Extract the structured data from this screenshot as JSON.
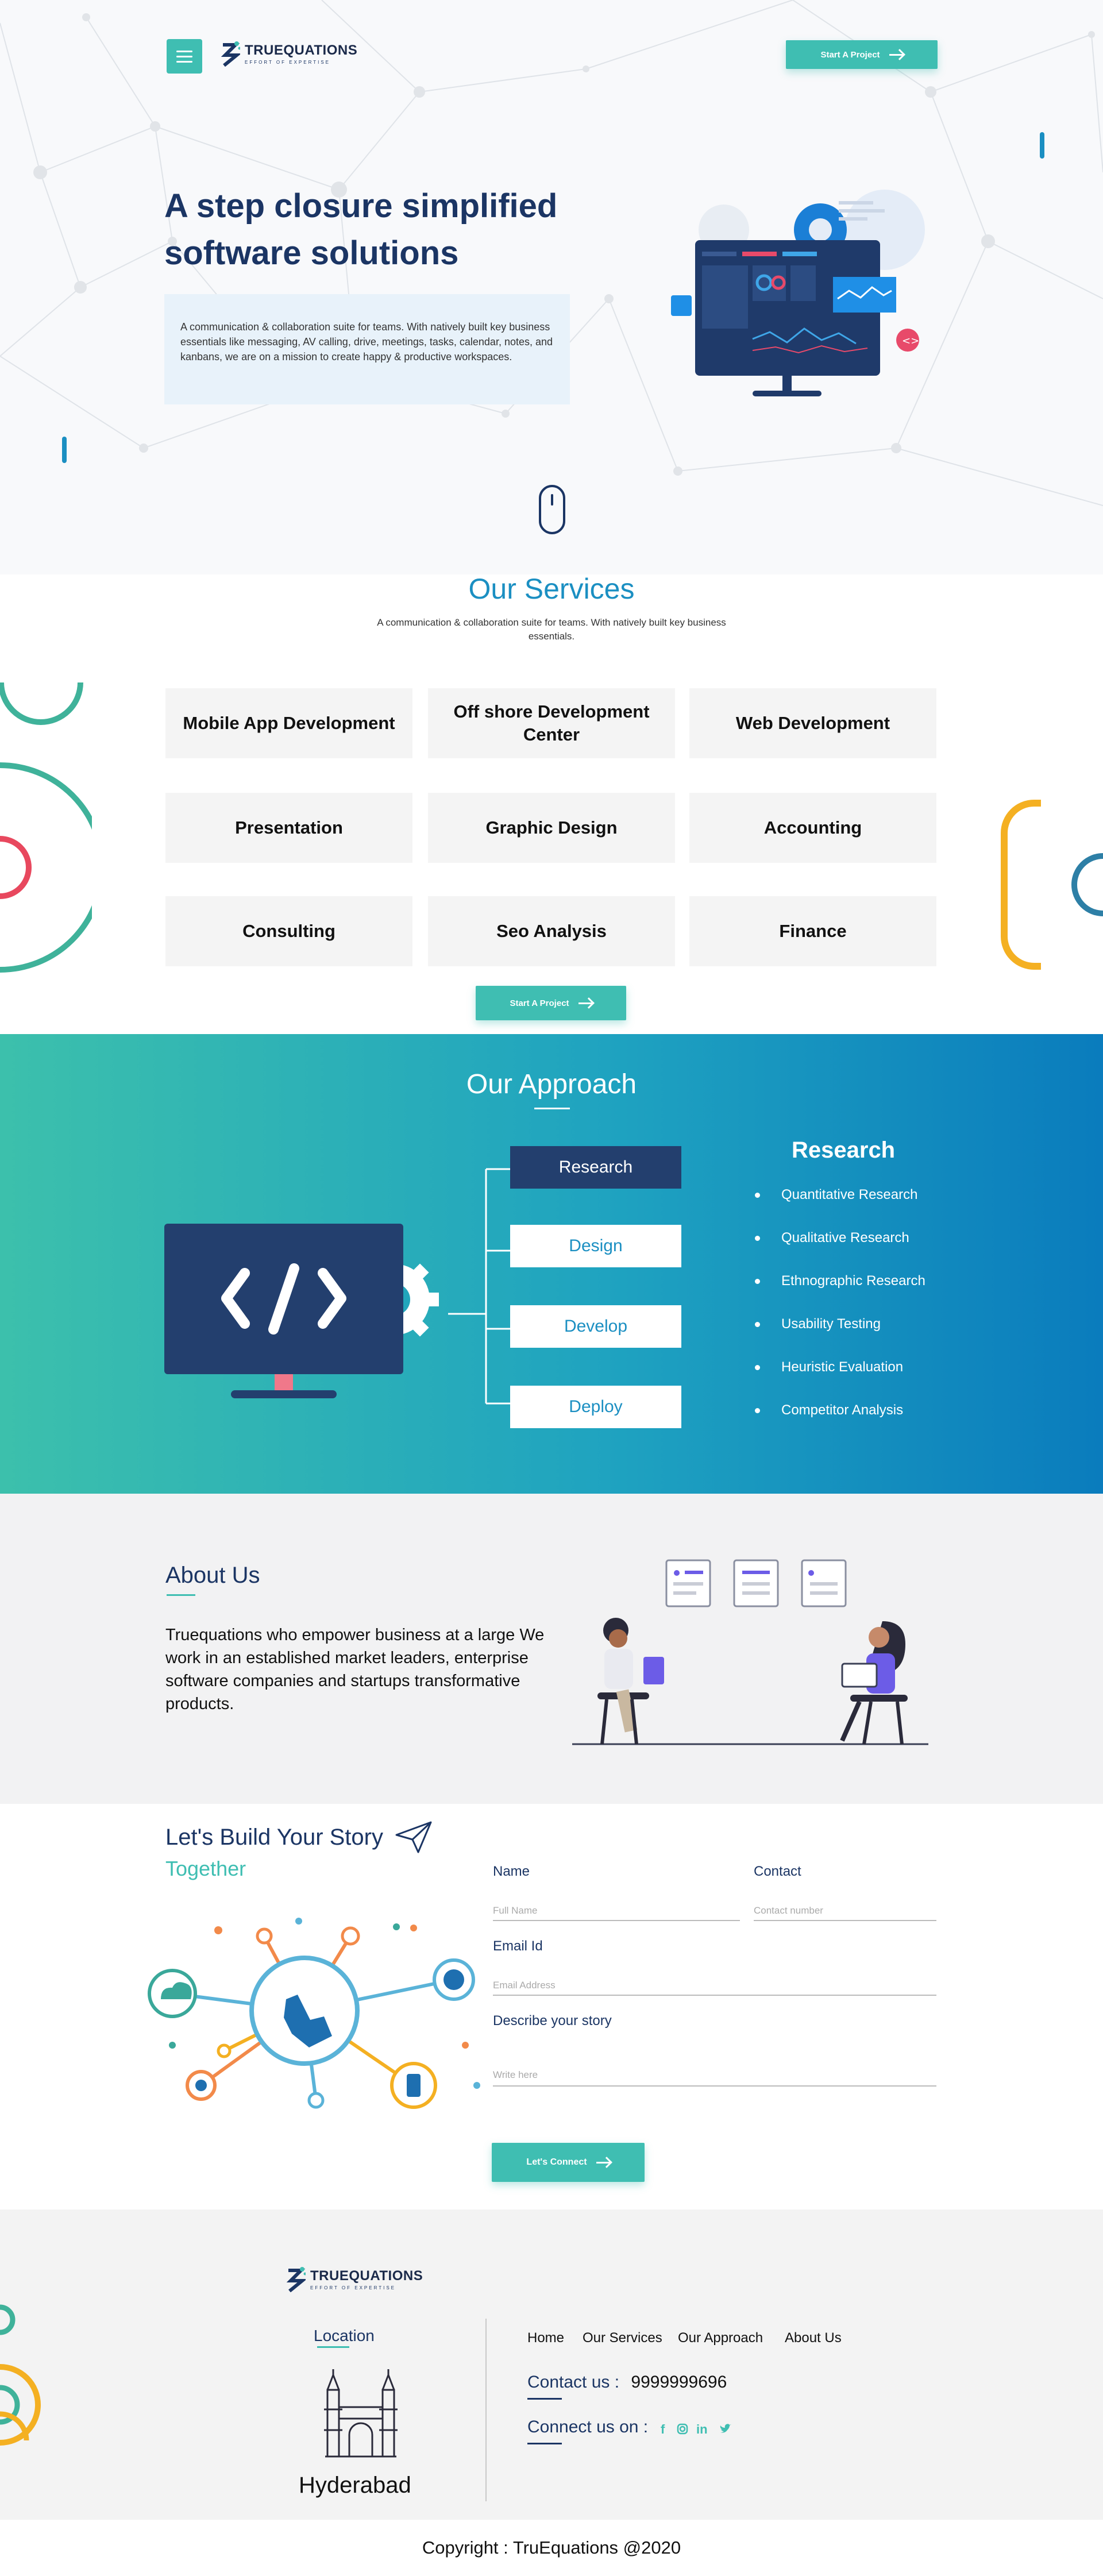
{
  "header": {
    "logo_name": "TRUEQUATIONS",
    "logo_tagline": "EFFORT OF EXPERTISE",
    "cta_label": "Start A Project"
  },
  "hero": {
    "title_line1": "A step closure simplified",
    "title_line2": "software solutions",
    "description": "A communication & collaboration suite for teams. With natively built key business essentials like messaging, AV calling, drive, meetings, tasks, calendar, notes, and kanbans, we are on a mission to create happy & productive workspaces."
  },
  "services": {
    "title": "Our Services",
    "subtitle": "A communication & collaboration suite for teams. With natively built key business essentials.",
    "items": [
      "Mobile App Development",
      "Off shore Development Center",
      "Web Development",
      "Presentation",
      "Graphic Design",
      "Accounting",
      "Consulting",
      "Seo Analysis",
      "Finance"
    ],
    "cta_label": "Start A Project"
  },
  "approach": {
    "title": "Our Approach",
    "steps": [
      "Research",
      "Design",
      "Develop",
      "Deploy"
    ],
    "active_step": "Research",
    "detail_title": "Research",
    "detail_items": [
      "Quantitative Research",
      "Qualitative Research",
      "Ethnographic Research",
      "Usability Testing",
      "Heuristic Evaluation",
      "Competitor Analysis"
    ]
  },
  "about": {
    "title": "About Us",
    "text": "Truequations who empower business at a large We work in an established market leaders, enterprise software companies and startups transformative products."
  },
  "story": {
    "title_line1": "Let's Build Your Story",
    "title_line2": "Together",
    "name_label": "Name",
    "name_placeholder": "Full Name",
    "contact_label": "Contact",
    "contact_placeholder": "Contact number",
    "email_label": "Email Id",
    "email_placeholder": "Email Address",
    "story_label": "Describe your story",
    "story_placeholder": "Write here",
    "submit_label": "Let's Connect"
  },
  "footer": {
    "logo_name": "TRUEQUATIONS",
    "logo_tagline": "EFFORT OF EXPERTISE",
    "location_label": "Location",
    "city": "Hyderabad",
    "nav": [
      "Home",
      "Our Services",
      "Our Approach",
      "About Us"
    ],
    "contact_label": "Contact us :",
    "contact_value": "9999999696",
    "connect_label": "Connect us on :",
    "social_icons": [
      "facebook-icon",
      "instagram-icon",
      "linkedin-icon",
      "twitter-icon"
    ],
    "copyright": "Copyright : TruEquations @2020"
  },
  "colors": {
    "teal": "#3fbeb2",
    "navy": "#1b3564",
    "blue": "#1b8fc2",
    "approach_gradient_start": "#3cc0ac",
    "approach_gradient_end": "#0a7cbd"
  }
}
